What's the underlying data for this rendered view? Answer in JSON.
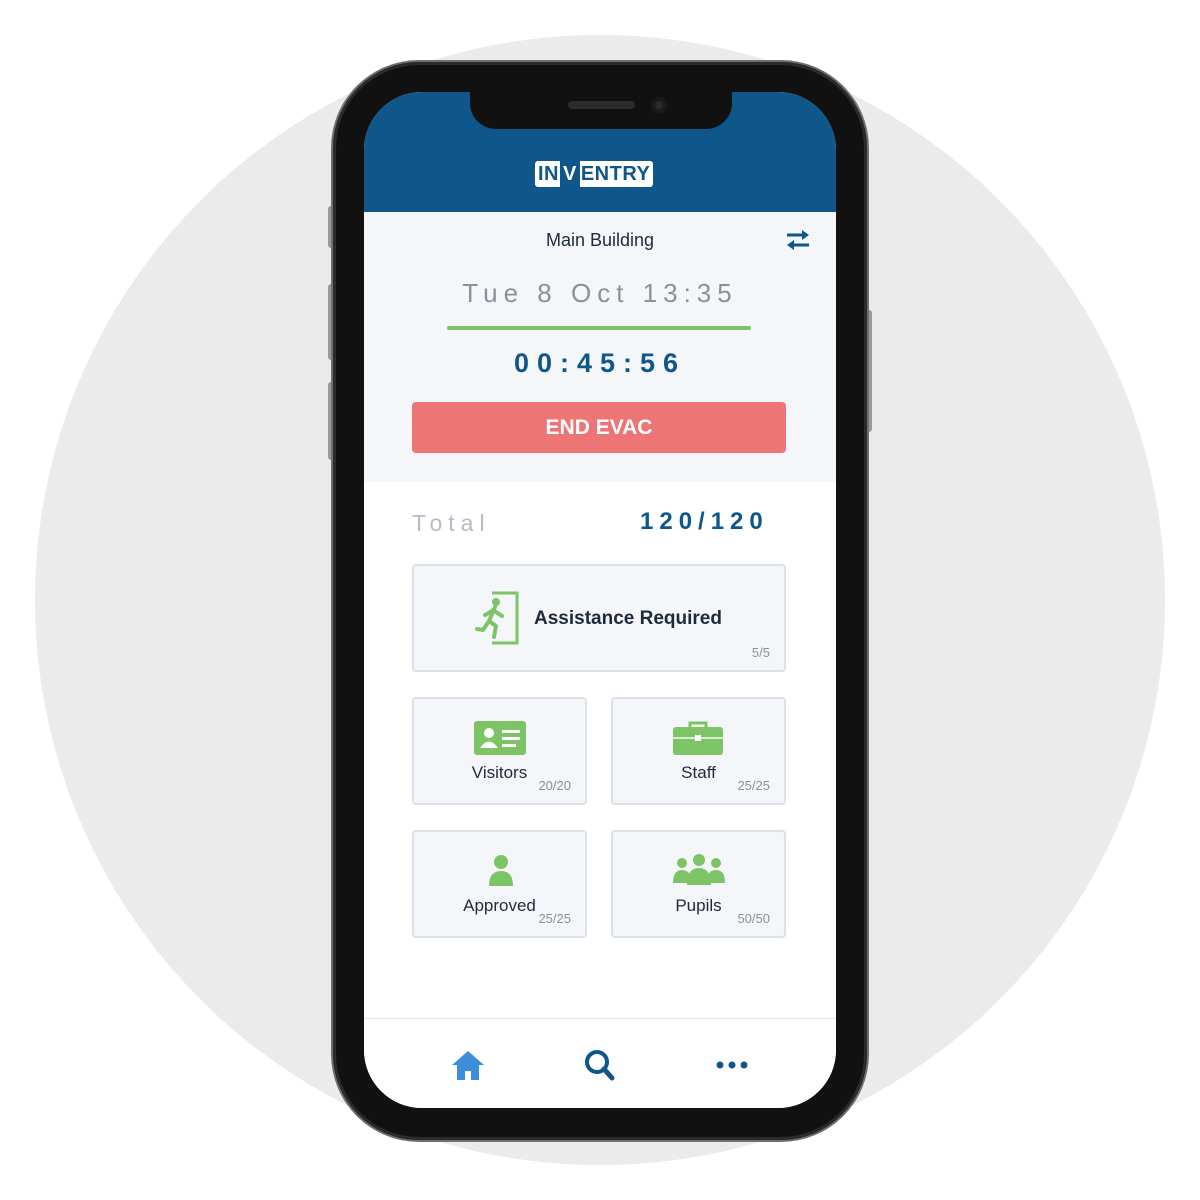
{
  "header": {
    "logo_in": "IN",
    "logo_v": "V",
    "logo_entry": "ENTRY"
  },
  "location": "Main Building",
  "datetime": "Tue 8 Oct 13:35",
  "progress": 1.0,
  "timer": "00:45:56",
  "end_button": "END EVAC",
  "total": {
    "label": "Total",
    "value": "120/120"
  },
  "cards": {
    "assistance": {
      "label": "Assistance Required",
      "count": "5/5"
    },
    "visitors": {
      "label": "Visitors",
      "count": "20/20"
    },
    "staff": {
      "label": "Staff",
      "count": "25/25"
    },
    "approved": {
      "label": "Approved",
      "count": "25/25"
    },
    "pupils": {
      "label": "Pupils",
      "count": "50/50"
    }
  },
  "colors": {
    "brand": "#0f568b",
    "accent_green": "#7cc465",
    "danger": "#ee7575"
  },
  "nav": {
    "icons": [
      "home-icon",
      "search-icon",
      "more-icon"
    ]
  }
}
